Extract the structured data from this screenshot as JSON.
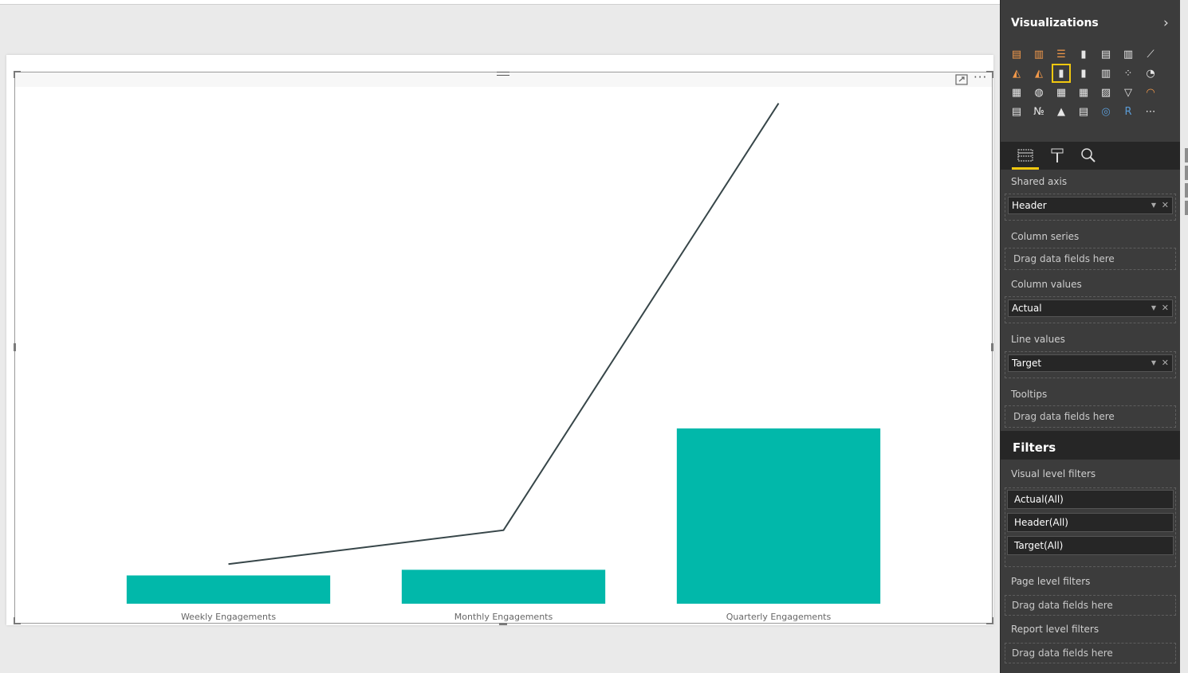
{
  "chart_data": {
    "type": "bar",
    "categories": [
      "Weekly Engagements",
      "Monthly Engagements",
      "Quarterly Engagements"
    ],
    "series": [
      {
        "name": "Actual",
        "kind": "column",
        "values": [
          1,
          1.2,
          6.2
        ],
        "color": "#01b8aa"
      },
      {
        "name": "Target",
        "kind": "line",
        "values": [
          1.4,
          2.6,
          17.7
        ],
        "color": "#374649"
      }
    ],
    "ylim": [
      0,
      18
    ],
    "grid": false,
    "legend": "none"
  },
  "visualizations": {
    "title": "Visualizations",
    "expand_icon": "chevron-right-icon",
    "gallery": [
      "stacked-bar-chart-icon",
      "stacked-column-chart-icon",
      "clustered-bar-chart-icon",
      "clustered-column-chart-icon",
      "100-stacked-bar-chart-icon",
      "100-stacked-column-chart-icon",
      "line-chart-icon",
      "area-chart-icon",
      "stacked-area-chart-icon",
      "line-and-stacked-column-chart-icon",
      "line-and-clustered-column-chart-icon",
      "ribbon-chart-icon",
      "scatter-chart-icon",
      "pie-chart-icon",
      "treemap-icon",
      "map-icon",
      "table-icon",
      "matrix-icon",
      "filled-map-icon",
      "funnel-icon",
      "gauge-icon",
      "multi-row-card-icon",
      "card-icon",
      "kpi-icon",
      "slicer-icon",
      "donut-chart-icon",
      "r-script-visual-icon",
      "more-options-icon"
    ],
    "selected_index": 9,
    "tabs": [
      "fields-tab-icon",
      "format-paintroller-icon",
      "analytics-magnifier-icon"
    ]
  },
  "wells": {
    "shared_axis": {
      "label": "Shared axis",
      "field": "Header"
    },
    "column_series": {
      "label": "Column series",
      "placeholder": "Drag data fields here"
    },
    "column_values": {
      "label": "Column values",
      "field": "Actual"
    },
    "line_values": {
      "label": "Line values",
      "field": "Target"
    },
    "tooltips": {
      "label": "Tooltips",
      "placeholder": "Drag data fields here"
    }
  },
  "filters": {
    "title": "Filters",
    "visual_level": {
      "label": "Visual level filters",
      "items": [
        "Actual(All)",
        "Header(All)",
        "Target(All)"
      ]
    },
    "page_level": {
      "label": "Page level filters",
      "placeholder": "Drag data fields here"
    },
    "report_level": {
      "label": "Report level filters",
      "placeholder": "Drag data fields here"
    }
  },
  "colors": {
    "accent": "#f2c80f",
    "pane_bg": "#3c3c3c"
  }
}
